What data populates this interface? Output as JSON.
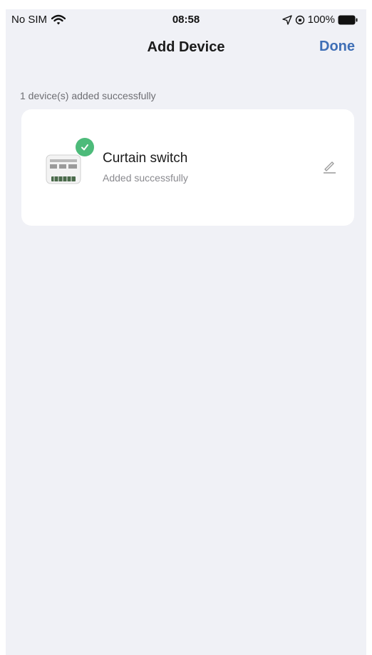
{
  "status_bar": {
    "carrier": "No SIM",
    "time": "08:58",
    "battery": "100%",
    "icons": [
      "wifi-icon",
      "location-arrow-icon",
      "orientation-lock-icon",
      "battery-icon"
    ]
  },
  "nav": {
    "title": "Add Device",
    "done_label": "Done"
  },
  "summary_text": "1 device(s) added successfully",
  "device": {
    "name": "Curtain switch",
    "status": "Added successfully",
    "icons": [
      "device-thumbnail",
      "check-icon",
      "edit-pencil-icon"
    ]
  },
  "colors": {
    "background": "#f0f1f6",
    "card": "#ffffff",
    "accent": "#3f6fb6",
    "success": "#4dbb7a"
  }
}
